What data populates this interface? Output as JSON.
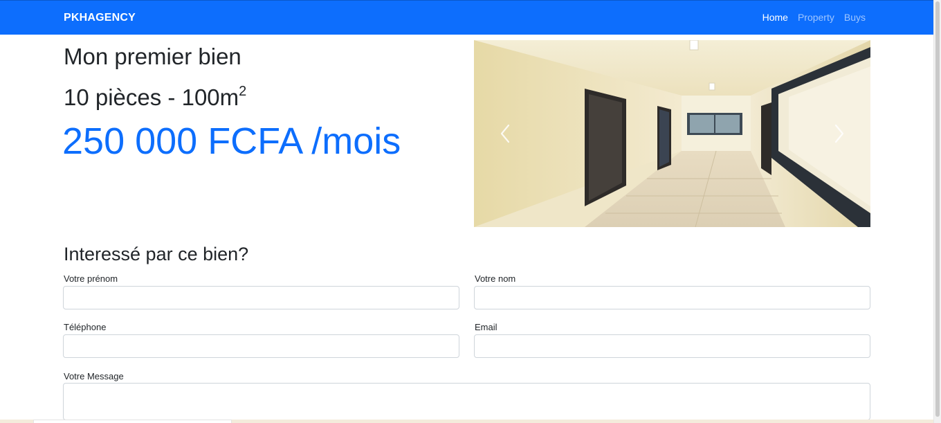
{
  "navbar": {
    "brand": "PKHAGENCY",
    "links": [
      {
        "label": "Home",
        "active": true
      },
      {
        "label": "Property",
        "active": false
      },
      {
        "label": "Buys",
        "active": false
      }
    ],
    "color": "#0d6efd"
  },
  "listing": {
    "title": "Mon premier bien",
    "rooms_area": "10 pièces - 100m",
    "area_exponent": "2",
    "price": "250 000 FCFA /mois",
    "accent": "#0d6efd"
  },
  "carousel": {
    "prev_icon": "chevron-left-icon",
    "next_icon": "chevron-right-icon"
  },
  "contact_form": {
    "heading": "Interessé par ce bien?",
    "first_name_label": "Votre prénom",
    "first_name_value": "",
    "last_name_label": "Votre nom",
    "last_name_value": "",
    "phone_label": "Téléphone",
    "phone_value": "",
    "email_label": "Email",
    "email_value": "",
    "message_label": "Votre Message",
    "message_value": ""
  }
}
